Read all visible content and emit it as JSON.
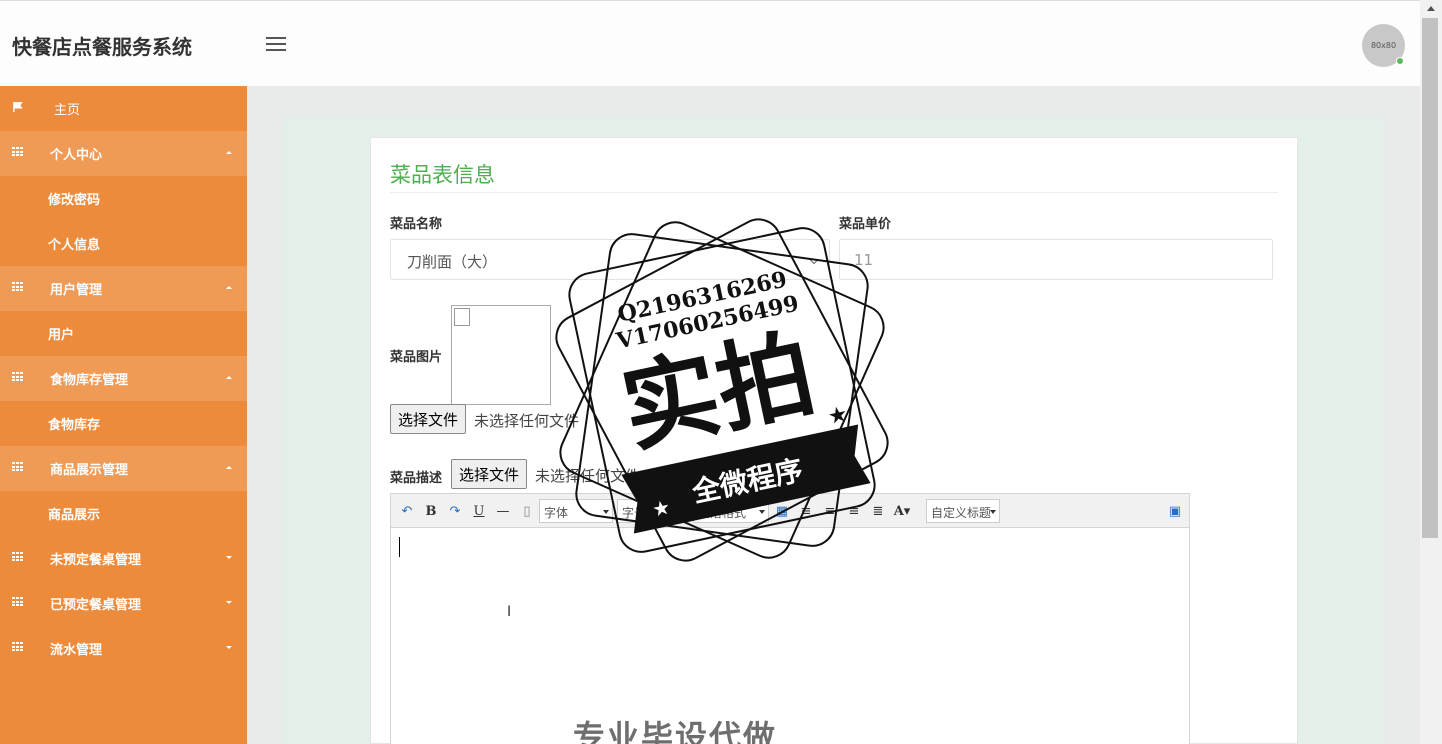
{
  "header": {
    "title": "快餐店点餐服务系统",
    "avatar_text": "80x80"
  },
  "sidebar": {
    "home": "主页",
    "groups": [
      {
        "label": "个人中心",
        "open": true,
        "items": [
          "修改密码",
          "个人信息"
        ]
      },
      {
        "label": "用户管理",
        "open": true,
        "items": [
          "用户"
        ]
      },
      {
        "label": "食物库存管理",
        "open": true,
        "items": [
          "食物库存"
        ]
      },
      {
        "label": "商品展示管理",
        "open": true,
        "items": [
          "商品展示"
        ]
      },
      {
        "label": "未预定餐桌管理",
        "open": false,
        "items": []
      },
      {
        "label": "已预定餐桌管理",
        "open": false,
        "items": []
      },
      {
        "label": "流水管理",
        "open": false,
        "items": []
      }
    ]
  },
  "form": {
    "title": "菜品表信息",
    "name_label": "菜品名称",
    "name_value": "刀削面（大）",
    "price_label": "菜品单价",
    "price_value": "11",
    "image_label": "菜品图片",
    "file_button": "选择文件",
    "file_none": "未选择任何文件",
    "desc_label": "菜品描述"
  },
  "editor": {
    "font_select": "字体",
    "size_select": "字号",
    "para_select": "段落格式",
    "custom_title": "自定义标题"
  },
  "watermark": {
    "line1": "Q2196316269",
    "line2": "V17060256499",
    "main": "实拍",
    "banner": "全微程序",
    "bottom": "专业毕设代做"
  },
  "colors": {
    "sidebar": "#ed8b3d",
    "accent": "#4caf50"
  }
}
